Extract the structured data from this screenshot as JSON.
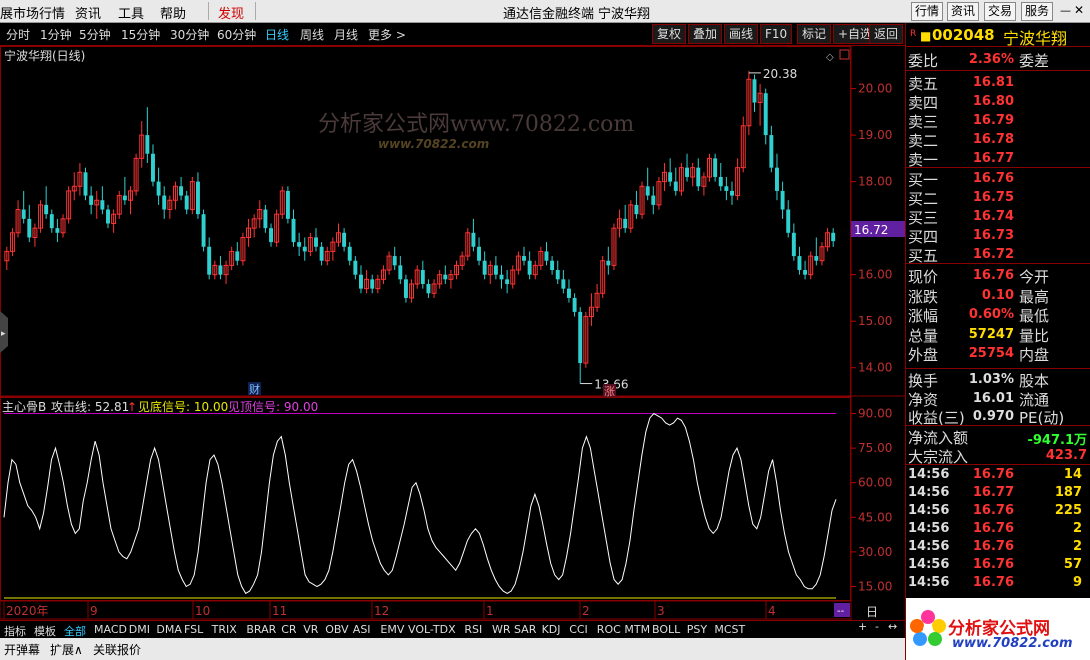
{
  "menu": {
    "items": [
      "展市场行情",
      "资讯",
      "工具",
      "帮助",
      "发现"
    ],
    "title": "通达信金融终端",
    "stock_title": "宁波华翔",
    "right_buttons": [
      "行情",
      "资讯",
      "交易",
      "服务"
    ]
  },
  "periods": [
    "分时",
    "1分钟",
    "5分钟",
    "15分钟",
    "30分钟",
    "60分钟",
    "日线",
    "周线",
    "月线",
    "更多 >"
  ],
  "active_period": "日线",
  "toolbar": [
    "复权",
    "叠加",
    "画线",
    "F10",
    "标记",
    "+自选",
    "返回"
  ],
  "chart_title": "宁波华翔(日线)",
  "watermark": {
    "text": "分析家公式网www.70822.com",
    "sub": "www.70822.com"
  },
  "price_axis": {
    "ticks": [
      "20.00",
      "19.00",
      "18.00",
      "17.00",
      "16.00",
      "15.00",
      "14.00"
    ],
    "current": "16.72"
  },
  "high_label": "20.38",
  "low_label": "13.66",
  "marker_cai": "财",
  "marker_zhang": "涨",
  "indicator": {
    "name": "主心骨B",
    "line_label": "攻击线: 52.81",
    "bottom_signal": "见底信号: 10.00",
    "top_signal": "见顶信号: 90.00",
    "ticks": [
      "90.00",
      "75.00",
      "60.00",
      "45.00",
      "30.00",
      "15.00"
    ]
  },
  "date_axis": [
    "2020年",
    "9",
    "10",
    "11",
    "12",
    "1",
    "2",
    "3",
    "4"
  ],
  "chart_data": {
    "type": "line",
    "indicator_series": {
      "name": "攻击线",
      "values": [
        45,
        60,
        70,
        68,
        60,
        55,
        50,
        48,
        45,
        40,
        47,
        58,
        70,
        75,
        68,
        60,
        50,
        42,
        38,
        40,
        52,
        60,
        70,
        78,
        72,
        60,
        50,
        40,
        35,
        30,
        28,
        27,
        30,
        35,
        40,
        50,
        60,
        70,
        75,
        70,
        60,
        50,
        40,
        30,
        22,
        18,
        15,
        16,
        20,
        30,
        45,
        60,
        70,
        72,
        68,
        60,
        50,
        40,
        30,
        20,
        15,
        12,
        13,
        16,
        20,
        30,
        45,
        60,
        72,
        78,
        80,
        72,
        60,
        50,
        40,
        30,
        20,
        17,
        16,
        15,
        16,
        18,
        22,
        30,
        40,
        50,
        60,
        68,
        70,
        65,
        58,
        50,
        42,
        35,
        30,
        25,
        22,
        20,
        22,
        28,
        35,
        42,
        50,
        58,
        60,
        55,
        48,
        40,
        35,
        32,
        30,
        28,
        26,
        24,
        22,
        25,
        30,
        35,
        38,
        40,
        38,
        33,
        27,
        22,
        18,
        15,
        13,
        12,
        13,
        16,
        22,
        30,
        40,
        50,
        55,
        50,
        42,
        33,
        25,
        20,
        18,
        20,
        28,
        38,
        50,
        62,
        75,
        80,
        75,
        65,
        55,
        45,
        35,
        25,
        18,
        16,
        18,
        25,
        35,
        48,
        60,
        72,
        82,
        88,
        90,
        89,
        88,
        86,
        85,
        86,
        88,
        87,
        84,
        78,
        70,
        60,
        52,
        45,
        40,
        38,
        40,
        45,
        55,
        65,
        72,
        75,
        70,
        60,
        50,
        42,
        40,
        45,
        55,
        65,
        70,
        60,
        48,
        38,
        30,
        25,
        20,
        18,
        15,
        14,
        14,
        16,
        20,
        28,
        38,
        48,
        52.81
      ]
    },
    "candles": {
      "note": "daily OHLC approximated",
      "ohlc": [
        [
          16.3,
          16.6,
          16.1,
          16.5
        ],
        [
          16.5,
          17.0,
          16.4,
          16.9
        ],
        [
          16.9,
          17.6,
          16.8,
          17.4
        ],
        [
          17.4,
          17.8,
          17.1,
          17.2
        ],
        [
          17.2,
          17.5,
          16.7,
          16.8
        ],
        [
          16.8,
          17.1,
          16.6,
          17.0
        ],
        [
          17.0,
          17.6,
          16.9,
          17.5
        ],
        [
          17.5,
          17.9,
          17.2,
          17.3
        ],
        [
          17.3,
          17.4,
          16.9,
          17.0
        ],
        [
          17.0,
          17.2,
          16.7,
          16.9
        ],
        [
          16.9,
          17.3,
          16.8,
          17.2
        ],
        [
          17.2,
          17.9,
          17.1,
          17.8
        ],
        [
          17.8,
          18.2,
          17.6,
          17.9
        ],
        [
          17.9,
          18.4,
          17.7,
          18.2
        ],
        [
          18.2,
          18.3,
          17.6,
          17.7
        ],
        [
          17.7,
          17.9,
          17.3,
          17.5
        ],
        [
          17.5,
          17.8,
          17.2,
          17.6
        ],
        [
          17.6,
          17.9,
          17.3,
          17.4
        ],
        [
          17.4,
          17.5,
          17.0,
          17.1
        ],
        [
          17.1,
          17.4,
          16.9,
          17.3
        ],
        [
          17.3,
          17.8,
          17.2,
          17.7
        ],
        [
          17.7,
          18.1,
          17.5,
          17.6
        ],
        [
          17.6,
          17.9,
          17.3,
          17.8
        ],
        [
          17.8,
          18.6,
          17.7,
          18.5
        ],
        [
          18.5,
          19.3,
          18.3,
          19.0
        ],
        [
          19.0,
          19.6,
          18.4,
          18.6
        ],
        [
          18.6,
          18.8,
          17.9,
          18.0
        ],
        [
          18.0,
          18.3,
          17.5,
          17.7
        ],
        [
          17.7,
          17.9,
          17.2,
          17.4
        ],
        [
          17.4,
          17.7,
          17.2,
          17.6
        ],
        [
          17.6,
          18.0,
          17.4,
          17.9
        ],
        [
          17.9,
          18.1,
          17.6,
          17.7
        ],
        [
          17.7,
          17.8,
          17.3,
          17.4
        ],
        [
          17.4,
          18.1,
          17.3,
          18.0
        ],
        [
          18.0,
          18.2,
          17.2,
          17.3
        ],
        [
          17.3,
          17.4,
          16.5,
          16.6
        ],
        [
          16.6,
          16.8,
          15.9,
          16.0
        ],
        [
          16.0,
          16.3,
          15.9,
          16.2
        ],
        [
          16.2,
          16.4,
          15.9,
          16.0
        ],
        [
          16.0,
          16.3,
          15.8,
          16.2
        ],
        [
          16.2,
          16.6,
          16.1,
          16.5
        ],
        [
          16.5,
          16.7,
          16.2,
          16.3
        ],
        [
          16.3,
          16.9,
          16.2,
          16.8
        ],
        [
          16.8,
          17.2,
          16.6,
          17.0
        ],
        [
          17.0,
          17.3,
          16.8,
          17.2
        ],
        [
          17.2,
          17.6,
          17.0,
          17.4
        ],
        [
          17.4,
          17.5,
          16.9,
          17.0
        ],
        [
          17.0,
          17.1,
          16.6,
          16.7
        ],
        [
          16.7,
          17.4,
          16.6,
          17.3
        ],
        [
          17.3,
          17.9,
          17.2,
          17.8
        ],
        [
          17.8,
          17.9,
          17.1,
          17.2
        ],
        [
          17.2,
          17.4,
          16.6,
          16.7
        ],
        [
          16.7,
          16.9,
          16.4,
          16.6
        ],
        [
          16.6,
          16.8,
          16.3,
          16.5
        ],
        [
          16.5,
          16.9,
          16.4,
          16.8
        ],
        [
          16.8,
          17.0,
          16.5,
          16.6
        ],
        [
          16.6,
          16.7,
          16.2,
          16.3
        ],
        [
          16.3,
          16.6,
          16.2,
          16.5
        ],
        [
          16.5,
          16.8,
          16.3,
          16.7
        ],
        [
          16.7,
          17.1,
          16.6,
          16.9
        ],
        [
          16.9,
          17.0,
          16.5,
          16.6
        ],
        [
          16.6,
          16.7,
          16.2,
          16.3
        ],
        [
          16.3,
          16.4,
          15.9,
          16.0
        ],
        [
          16.0,
          16.2,
          15.6,
          15.7
        ],
        [
          15.7,
          16.1,
          15.6,
          15.9
        ],
        [
          15.9,
          16.0,
          15.6,
          15.7
        ],
        [
          15.7,
          16.0,
          15.6,
          15.9
        ],
        [
          15.9,
          16.2,
          15.8,
          16.1
        ],
        [
          16.1,
          16.5,
          16.0,
          16.4
        ],
        [
          16.4,
          16.6,
          16.1,
          16.2
        ],
        [
          16.2,
          16.4,
          15.8,
          15.9
        ],
        [
          15.9,
          16.0,
          15.4,
          15.5
        ],
        [
          15.5,
          15.9,
          15.4,
          15.8
        ],
        [
          15.8,
          16.2,
          15.7,
          16.1
        ],
        [
          16.1,
          16.3,
          15.7,
          15.8
        ],
        [
          15.8,
          15.9,
          15.5,
          15.6
        ],
        [
          15.6,
          15.9,
          15.5,
          15.8
        ],
        [
          15.8,
          16.1,
          15.7,
          16.0
        ],
        [
          16.0,
          16.2,
          15.8,
          15.9
        ],
        [
          15.9,
          16.1,
          15.7,
          16.0
        ],
        [
          16.0,
          16.3,
          15.9,
          16.2
        ],
        [
          16.2,
          16.5,
          16.1,
          16.4
        ],
        [
          16.4,
          17.0,
          16.3,
          16.9
        ],
        [
          16.9,
          17.2,
          16.5,
          16.6
        ],
        [
          16.6,
          16.8,
          16.2,
          16.3
        ],
        [
          16.3,
          16.5,
          15.9,
          16.0
        ],
        [
          16.0,
          16.3,
          15.8,
          16.2
        ],
        [
          16.2,
          16.4,
          15.9,
          16.0
        ],
        [
          16.0,
          16.2,
          15.7,
          15.9
        ],
        [
          15.9,
          16.1,
          15.6,
          15.8
        ],
        [
          15.8,
          16.2,
          15.7,
          16.1
        ],
        [
          16.1,
          16.5,
          16.0,
          16.4
        ],
        [
          16.4,
          16.6,
          16.2,
          16.3
        ],
        [
          16.3,
          16.5,
          15.9,
          16.0
        ],
        [
          16.0,
          16.3,
          15.9,
          16.2
        ],
        [
          16.2,
          16.6,
          16.1,
          16.5
        ],
        [
          16.5,
          16.7,
          16.2,
          16.3
        ],
        [
          16.3,
          16.4,
          16.0,
          16.1
        ],
        [
          16.1,
          16.3,
          15.8,
          15.9
        ],
        [
          15.9,
          16.1,
          15.6,
          15.7
        ],
        [
          15.7,
          15.9,
          15.4,
          15.5
        ],
        [
          15.5,
          15.6,
          15.1,
          15.2
        ],
        [
          15.2,
          15.3,
          13.66,
          14.1
        ],
        [
          14.1,
          15.2,
          14.0,
          15.1
        ],
        [
          15.1,
          15.6,
          14.9,
          15.3
        ],
        [
          15.3,
          15.8,
          15.2,
          15.6
        ],
        [
          15.6,
          16.4,
          15.5,
          16.3
        ],
        [
          16.3,
          16.6,
          16.0,
          16.2
        ],
        [
          16.2,
          17.1,
          16.1,
          17.0
        ],
        [
          17.0,
          17.4,
          16.8,
          17.2
        ],
        [
          17.2,
          17.5,
          16.9,
          17.0
        ],
        [
          17.0,
          17.6,
          16.9,
          17.5
        ],
        [
          17.5,
          17.8,
          17.2,
          17.3
        ],
        [
          17.3,
          18.0,
          17.2,
          17.9
        ],
        [
          17.9,
          18.3,
          17.6,
          17.7
        ],
        [
          17.7,
          17.9,
          17.3,
          17.5
        ],
        [
          17.5,
          18.1,
          17.4,
          18.0
        ],
        [
          18.0,
          18.4,
          17.8,
          18.2
        ],
        [
          18.2,
          18.5,
          17.9,
          18.0
        ],
        [
          18.0,
          18.3,
          17.7,
          17.8
        ],
        [
          17.8,
          18.4,
          17.7,
          18.3
        ],
        [
          18.3,
          18.6,
          18.0,
          18.1
        ],
        [
          18.1,
          18.4,
          17.9,
          18.3
        ],
        [
          18.3,
          18.5,
          17.8,
          17.9
        ],
        [
          17.9,
          18.2,
          17.7,
          18.1
        ],
        [
          18.1,
          18.6,
          18.0,
          18.5
        ],
        [
          18.5,
          18.6,
          18.0,
          18.1
        ],
        [
          18.1,
          18.4,
          17.8,
          17.9
        ],
        [
          17.9,
          18.1,
          17.6,
          17.8
        ],
        [
          17.8,
          18.0,
          17.5,
          17.7
        ],
        [
          17.7,
          18.5,
          17.6,
          18.3
        ],
        [
          18.3,
          19.4,
          18.2,
          19.2
        ],
        [
          19.2,
          20.38,
          19.0,
          20.2
        ],
        [
          20.2,
          20.3,
          19.5,
          19.7
        ],
        [
          19.7,
          20.1,
          19.2,
          19.9
        ],
        [
          19.9,
          20.0,
          18.8,
          19.0
        ],
        [
          19.0,
          19.2,
          18.2,
          18.3
        ],
        [
          18.3,
          18.6,
          17.6,
          17.8
        ],
        [
          17.8,
          18.0,
          17.2,
          17.4
        ],
        [
          17.4,
          17.6,
          16.8,
          16.9
        ],
        [
          16.9,
          17.1,
          16.3,
          16.4
        ],
        [
          16.4,
          16.6,
          16.0,
          16.1
        ],
        [
          16.1,
          16.3,
          15.9,
          16.0
        ],
        [
          16.0,
          16.5,
          15.9,
          16.4
        ],
        [
          16.4,
          16.8,
          16.2,
          16.3
        ],
        [
          16.3,
          16.7,
          16.2,
          16.6
        ],
        [
          16.6,
          17.0,
          16.5,
          16.9
        ],
        [
          16.9,
          17.0,
          16.6,
          16.72
        ]
      ]
    },
    "ylim": [
      13.5,
      20.7
    ],
    "indicator_ylim": [
      10,
      95
    ]
  },
  "quote": {
    "code": "002048",
    "name": "宁波华翔",
    "weibi_label": "委比",
    "weibi_value": "2.36%",
    "weicha_label": "委差",
    "asks": [
      [
        "卖五",
        "16.81"
      ],
      [
        "卖四",
        "16.80"
      ],
      [
        "卖三",
        "16.79"
      ],
      [
        "卖二",
        "16.78"
      ],
      [
        "卖一",
        "16.77"
      ]
    ],
    "bids": [
      [
        "买一",
        "16.76"
      ],
      [
        "买二",
        "16.75"
      ],
      [
        "买三",
        "16.74"
      ],
      [
        "买四",
        "16.73"
      ],
      [
        "买五",
        "16.72"
      ]
    ],
    "stats": [
      [
        "现价",
        "16.76",
        "今开"
      ],
      [
        "涨跌",
        "0.10",
        "最高"
      ],
      [
        "涨幅",
        "0.60%",
        "最低"
      ],
      [
        "总量",
        "57247",
        "量比"
      ],
      [
        "外盘",
        "25754",
        "内盘"
      ]
    ],
    "stats2": [
      [
        "换手",
        "1.03%",
        "股本"
      ],
      [
        "净资",
        "16.01",
        "流通"
      ],
      [
        "收益(三)",
        "0.970",
        "PE(动)"
      ]
    ],
    "flows": [
      [
        "净流入额",
        "-947.1万"
      ],
      [
        "大宗流入",
        "423.7"
      ]
    ],
    "ticks": [
      [
        "14:56",
        "16.76",
        "14"
      ],
      [
        "14:56",
        "16.77",
        "187"
      ],
      [
        "14:56",
        "16.76",
        "225"
      ],
      [
        "14:56",
        "16.76",
        "2"
      ],
      [
        "14:56",
        "16.76",
        "2"
      ],
      [
        "14:56",
        "16.76",
        "57"
      ],
      [
        "14:56",
        "16.76",
        "9"
      ]
    ],
    "logo_text": "分析家公式网",
    "logo_url": "www.70822.com"
  },
  "bottom_tabs": [
    "指标",
    "模板",
    "全部",
    "MACD",
    "DMI",
    "DMA",
    "FSL",
    "TRIX",
    "BRAR",
    "CR",
    "VR",
    "OBV",
    "ASI",
    "EMV",
    "VOL-TDX",
    "RSI",
    "WR",
    "SAR",
    "KDJ",
    "CCI",
    "ROC",
    "MTM",
    "BOLL",
    "PSY",
    "MCST"
  ],
  "status_items": [
    "开弹幕",
    "扩展∧",
    "关联报价"
  ],
  "colors": {
    "up": "#ff3333",
    "down": "#30d0d0",
    "axis": "#c00000",
    "indicator": "#ffffff",
    "purple": "#c000c0",
    "yellow": "#e8e800"
  }
}
